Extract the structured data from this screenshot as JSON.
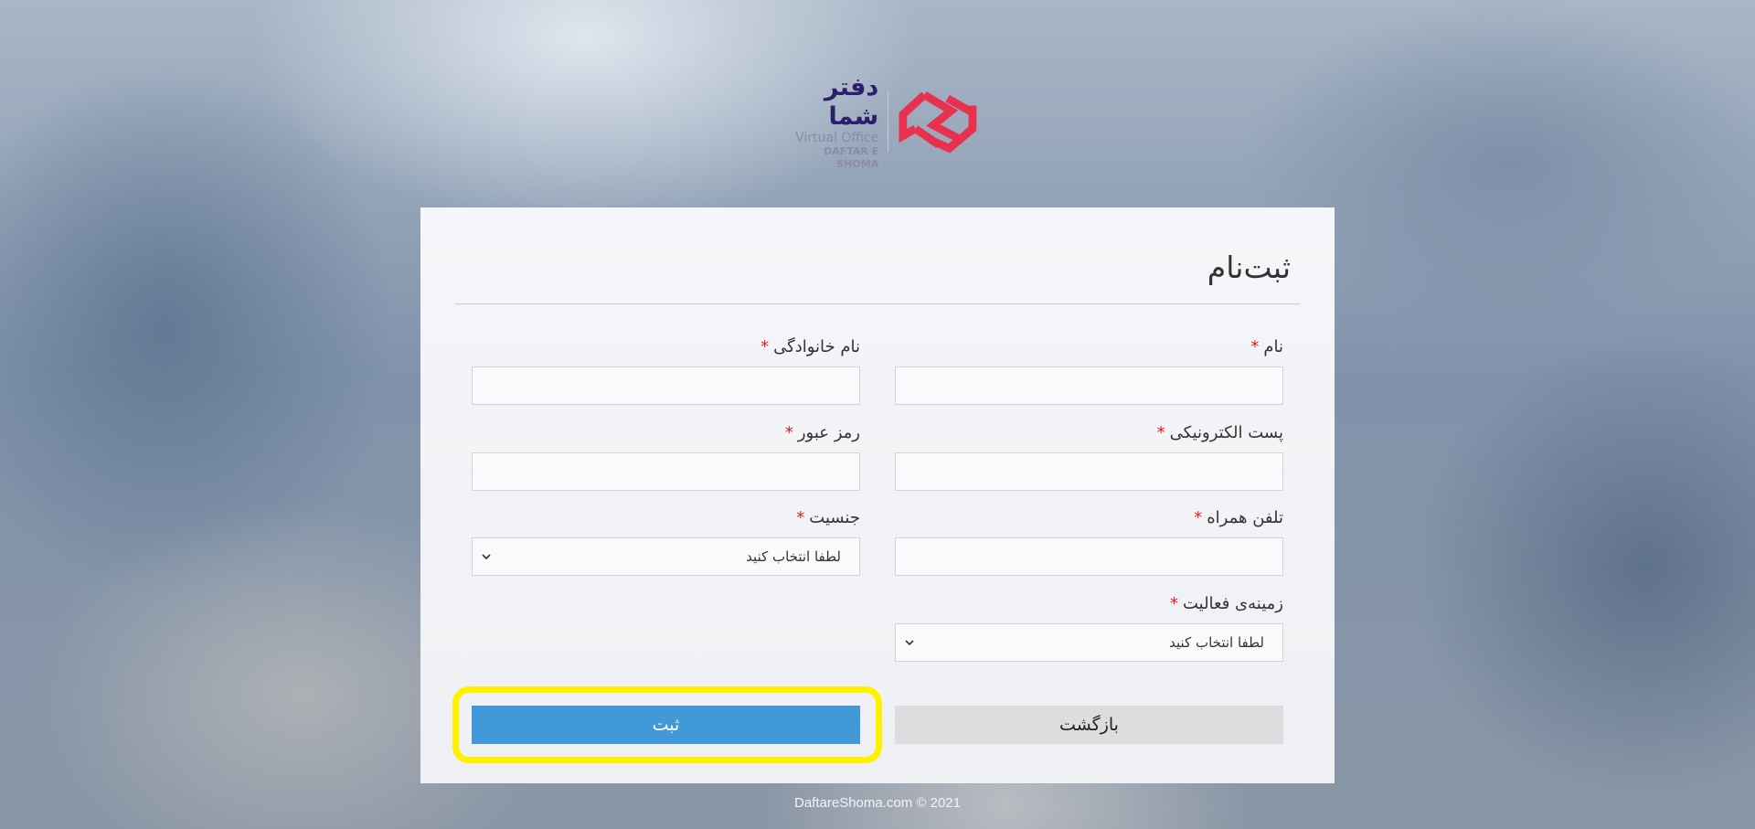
{
  "logo": {
    "name_fa": "دفتر شما",
    "line1": "Virtual Office",
    "line2": "DAFTAR E SHOMA"
  },
  "form": {
    "title": "ثبت‌نام",
    "required_mark": "*",
    "fields": {
      "first_name": {
        "label": "نام",
        "value": ""
      },
      "last_name": {
        "label": "نام خانوادگی",
        "value": ""
      },
      "email": {
        "label": "پست الکترونیکی",
        "value": ""
      },
      "password": {
        "label": "رمز عبور",
        "value": ""
      },
      "mobile": {
        "label": "تلفن همراه",
        "value": ""
      },
      "gender": {
        "label": "جنسیت",
        "selected": "لطفا انتخاب کنید"
      },
      "activity": {
        "label": "زمینه‌ی فعالیت",
        "selected": "لطفا انتخاب کنید"
      }
    },
    "buttons": {
      "back": "بازگشت",
      "submit": "ثبت"
    }
  },
  "footer": {
    "text": "DaftareShoma.com © 2021"
  },
  "colors": {
    "accent": "#4299d8",
    "highlight": "#fff200",
    "required": "#e02020",
    "logo_mark": "#e8304f",
    "logo_text": "#2b1f6b"
  },
  "icons": {
    "logo": "daftar-shoma-logo-mark",
    "select_arrow": "chevron-down-icon"
  }
}
